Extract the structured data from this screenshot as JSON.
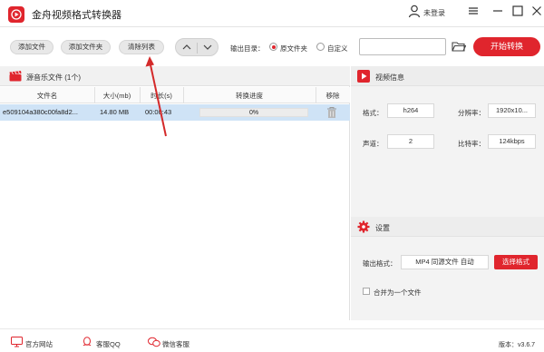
{
  "app": {
    "title": "金舟视频格式转换器",
    "user_label": "未登录",
    "brand_color": "#e0252d"
  },
  "toolbar": {
    "add_file": "添加文件",
    "add_folder": "添加文件夹",
    "clear_list": "清除列表",
    "output_label": "输出目录：",
    "radio_source": "原文件夹",
    "radio_custom": "自定义",
    "selected_output": "原文件夹",
    "path_value": "",
    "start_button": "开始转换"
  },
  "file_panel": {
    "title": "源音乐文件 (1个)",
    "columns": [
      "文件名",
      "大小(mb)",
      "时长(s)",
      "转换进度",
      "移除"
    ],
    "rows": [
      {
        "filename": "e509104a380c00fa8d2...",
        "size": "14.80 MB",
        "duration": "00:00:43",
        "progress_text": "0%",
        "progress": 0
      }
    ]
  },
  "video_info": {
    "title": "视频信息",
    "format_label": "格式：",
    "format_value": "h264",
    "resolution_label": "分辨率：",
    "resolution_value": "1920x10...",
    "channel_label": "声道：",
    "channel_value": "2",
    "bitrate_label": "比特率：",
    "bitrate_value": "124kbps"
  },
  "settings": {
    "title": "设置",
    "output_format_label": "输出格式：",
    "output_format_value": "MP4 同源文件 自动",
    "choose_format_button": "选择格式",
    "merge_label": "合并为一个文件",
    "merge_checked": false
  },
  "footer": {
    "website": "官方网站",
    "qq_support": "客服QQ",
    "wechat_support": "微信客服",
    "version": "版本：v3.6.7"
  }
}
